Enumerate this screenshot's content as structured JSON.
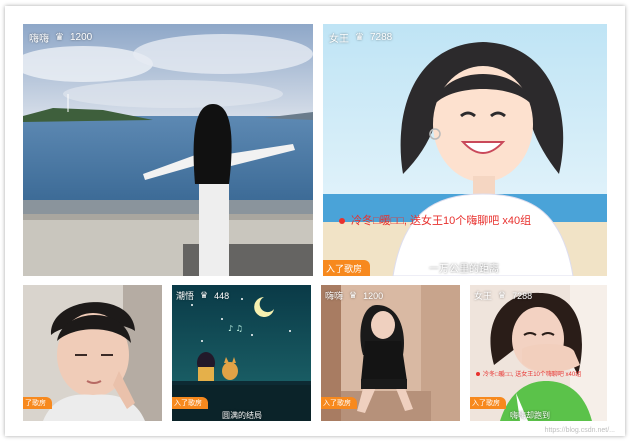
{
  "streams": [
    {
      "host": "嗨嗨",
      "count": "1200",
      "bottom": ""
    },
    {
      "host": "女王",
      "count": "7288",
      "gift": "冷冬□暖□□, 送女王10个嗨聊吧 x40组",
      "entered": "入了歌房",
      "bottom": "一万公里的距离"
    },
    {
      "host": "",
      "count": "",
      "entered": "了歌房",
      "bottom": ""
    },
    {
      "host": "潮悟",
      "count": "448",
      "entered": "入了歌房",
      "bottom": "圆满的结局"
    },
    {
      "host": "嗨嗨",
      "count": "1200",
      "entered": "入了歌房",
      "bottom": ""
    },
    {
      "host": "女王",
      "count": "7288",
      "gift": "冷冬□暖□□, 送女王10个嗨聊吧 x40组",
      "entered": "入了歌房",
      "bottom": "嗨嗨却跑到"
    }
  ],
  "watermark": "https://blog.csdn.net/...",
  "colors": {
    "accent": "#f7891e",
    "gift_text": "#e8312e"
  }
}
